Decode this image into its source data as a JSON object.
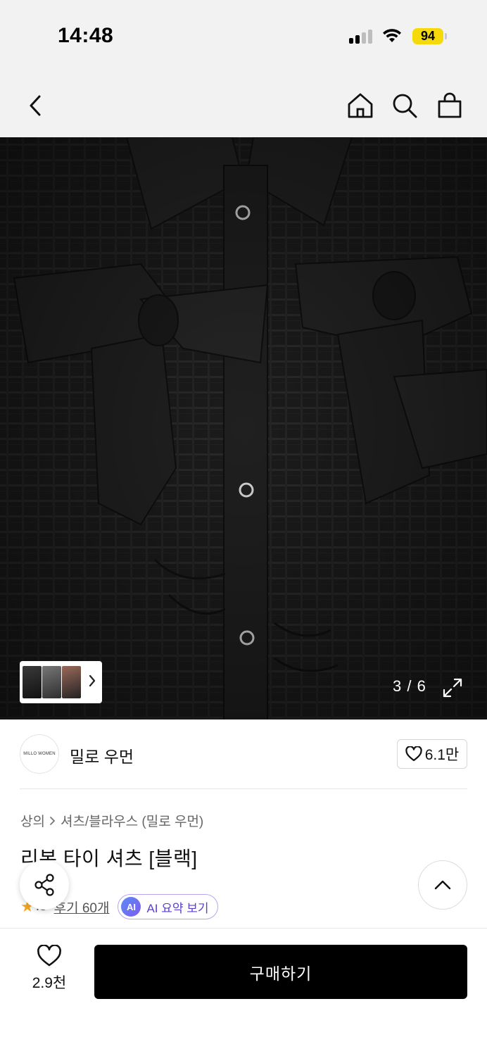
{
  "status_bar": {
    "time": "14:48",
    "battery": "94",
    "colors": {
      "battery": "#f5d90a"
    }
  },
  "nav": {
    "icons": [
      "back-icon",
      "home-icon",
      "search-icon",
      "bag-icon"
    ]
  },
  "gallery": {
    "counter": "3 / 6",
    "thumbnail_icons": [
      "thumbnail",
      "chevron-right-icon"
    ],
    "expand_icon": "expand-icon"
  },
  "brand": {
    "logo_text": "MILLO WOMEN",
    "name": "밀로 우먼",
    "likes": "6.1만"
  },
  "product": {
    "breadcrumb": [
      "상의",
      "셔츠/블라우스 (밀로 우먼)"
    ],
    "title": "리본 타이 셔츠 [블랙]",
    "rating_partial": ".8",
    "reviews": "후기 60개",
    "ai_badge": "AI",
    "ai_summary": "AI 요약 보기"
  },
  "bottom_bar": {
    "wish_count": "2.9천",
    "buy_label": "구매하기",
    "colors": {
      "buy_button": "#000000"
    }
  }
}
